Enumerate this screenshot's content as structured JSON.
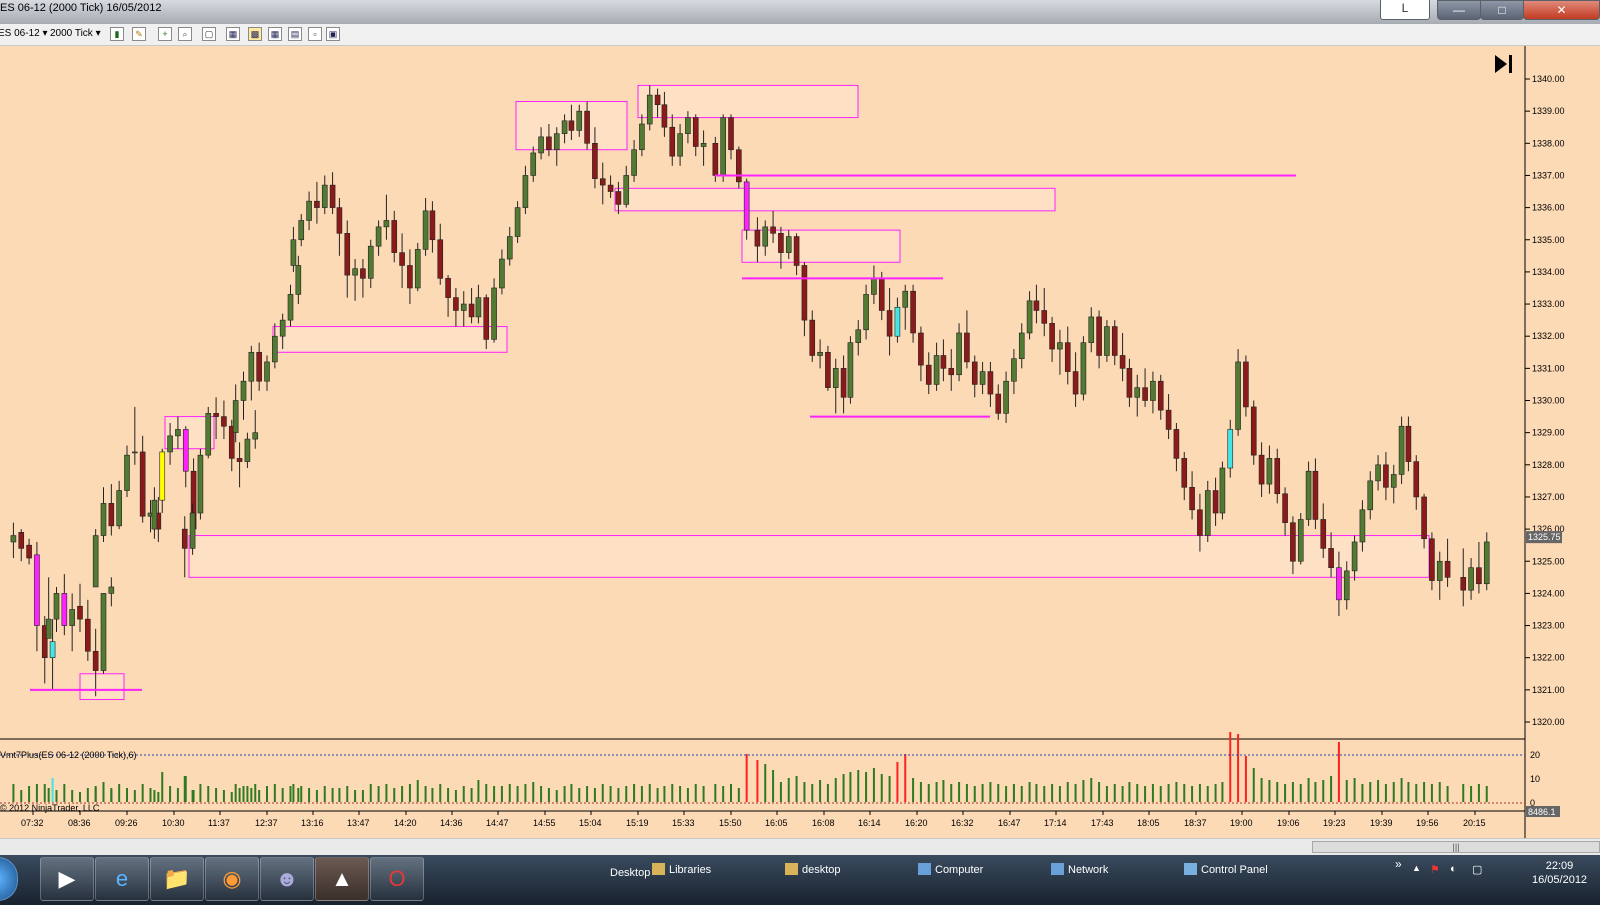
{
  "window": {
    "title": "ES 06-12 (2000 Tick)  16/05/2012",
    "layout_button": "L",
    "minimize_icon": "minimize-icon",
    "maximize_icon": "maximize-icon",
    "close_icon": "close-icon"
  },
  "toolbar": {
    "instrument": "ES 06-12",
    "interval": "2000 Tick",
    "icons": [
      "candlestick-icon",
      "pencil-icon",
      "crosshair-icon",
      "zoom-icon",
      "data-box-icon",
      "bars-icon",
      "chart-style-icon",
      "properties-icon",
      "template-icon"
    ]
  },
  "chart": {
    "background": "#fcdab6",
    "up_color": "#527a33",
    "down_color": "#8b1a1a",
    "accent_colors": {
      "magenta": "#ff22ff",
      "yellow": "#ffff00",
      "cyan": "#44e5e5",
      "blue": "#1414cc"
    },
    "price_axis": {
      "labels": [
        "1340.00",
        "1339.00",
        "1338.00",
        "1337.00",
        "1336.00",
        "1335.00",
        "1334.00",
        "1333.00",
        "1332.00",
        "1331.00",
        "1330.00",
        "1329.00",
        "1328.00",
        "1327.00",
        "1326.00",
        "1325.00",
        "1324.00",
        "1323.00",
        "1322.00",
        "1321.00",
        "1320.00"
      ],
      "current_price": "1325.75"
    },
    "time_axis": {
      "labels": [
        "07:32",
        "08:36",
        "09:26",
        "10:30",
        "11:37",
        "12:37",
        "13:16",
        "13:47",
        "14:20",
        "14:36",
        "14:47",
        "14:55",
        "15:04",
        "15:19",
        "15:33",
        "15:50",
        "16:05",
        "16:08",
        "16:14",
        "16:20",
        "16:32",
        "16:47",
        "17:14",
        "17:43",
        "18:05",
        "18:37",
        "19:00",
        "19:06",
        "19:23",
        "19:39",
        "19:56",
        "20:15"
      ]
    },
    "go_to_end_icon": "skip-to-end-icon"
  },
  "indicator": {
    "label": "Vmt7Plus(ES 06-12 (2000 Tick),6)",
    "axis_labels": [
      "20",
      "10",
      "0"
    ],
    "current_value": "8486.1",
    "copyright": "© 2012 NinjaTrader, LLC"
  },
  "chart_data": {
    "type": "candlestick",
    "instrument": "ES 06-12",
    "interval": "2000 Tick",
    "ylim": [
      1319.6,
      1340.6
    ],
    "volume_ylim": [
      0,
      23
    ],
    "current_price": 1325.75,
    "bars": []
  },
  "taskbar": {
    "apps": [
      "windows-start-icon",
      "media-player-icon",
      "internet-explorer-icon",
      "file-explorer-icon",
      "firefox-icon",
      "network-people-icon",
      "ninjatrader-icon",
      "opera-icon"
    ],
    "desktop_label": "Desktop",
    "links": [
      "Libraries",
      "desktop",
      "Computer",
      "Network",
      "Control Panel"
    ],
    "time": "22:09",
    "date": "16/05/2012"
  }
}
